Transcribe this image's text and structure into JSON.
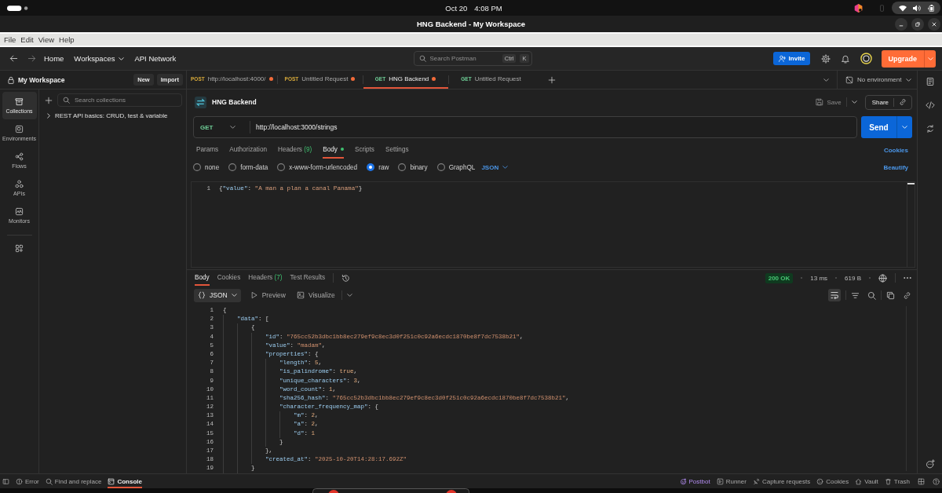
{
  "system_bar": {
    "date": "Oct 20",
    "time": "4:08 PM"
  },
  "window": {
    "title": "HNG Backend - My Workspace"
  },
  "menu": [
    "File",
    "Edit",
    "View",
    "Help"
  ],
  "header": {
    "nav": [
      {
        "label": "Home",
        "kind": "link"
      },
      {
        "label": "Workspaces",
        "kind": "menu"
      },
      {
        "label": "API Network",
        "kind": "link"
      }
    ],
    "search": {
      "placeholder": "Search Postman",
      "shortcut": [
        "Ctrl",
        "K"
      ]
    },
    "invite": "Invite",
    "upgrade": "Upgrade"
  },
  "sidebar": {
    "workspace": "My Workspace",
    "buttons": [
      "New",
      "Import"
    ],
    "nav": [
      {
        "label": "Collections",
        "selected": true
      },
      {
        "label": "Environments",
        "selected": false
      },
      {
        "label": "Flows",
        "selected": false
      },
      {
        "label": "APIs",
        "selected": false
      },
      {
        "label": "Monitors",
        "selected": false
      }
    ],
    "search": {
      "placeholder": "Search collections"
    },
    "collections": [
      {
        "name": "REST API basics: CRUD, test & variable",
        "expanded": false
      }
    ]
  },
  "tabs": [
    {
      "method": "POST",
      "color": "#d6a93a",
      "title": "http://localhost:4000/",
      "unsaved": true,
      "selected": false
    },
    {
      "method": "POST",
      "color": "#d6a93a",
      "title": "Untitled Request",
      "unsaved": true,
      "selected": false
    },
    {
      "method": "GET",
      "color": "#6fcf97",
      "title": "HNG Backend",
      "unsaved": true,
      "selected": true
    },
    {
      "method": "GET",
      "color": "#6fcf97",
      "title": "Untitled Request",
      "unsaved": false,
      "selected": false
    }
  ],
  "environment": "No environment",
  "request": {
    "title": "HNG Backend",
    "save": "Save",
    "share": "Share",
    "method": "GET",
    "url": "http://localhost:3000/strings",
    "send": "Send",
    "tabs": [
      {
        "label": "Params",
        "selected": false,
        "dot": false
      },
      {
        "label": "Authorization",
        "selected": false,
        "dot": false
      },
      {
        "label": "Headers",
        "count": "(9)",
        "selected": false,
        "dot": false
      },
      {
        "label": "Body",
        "selected": true,
        "dot": true
      },
      {
        "label": "Scripts",
        "selected": false,
        "dot": false
      },
      {
        "label": "Settings",
        "selected": false,
        "dot": false
      }
    ],
    "cookies": "Cookies",
    "body_types": [
      {
        "label": "none",
        "selected": false
      },
      {
        "label": "form-data",
        "selected": false
      },
      {
        "label": "x-www-form-urlencoded",
        "selected": false
      },
      {
        "label": "raw",
        "selected": true
      },
      {
        "label": "binary",
        "selected": false
      },
      {
        "label": "GraphQL",
        "selected": false
      }
    ],
    "format": "JSON",
    "beautify": "Beautify",
    "body_lines": [
      {
        "number": "1",
        "tokens": [
          {
            "kind": "punct",
            "text": "{"
          },
          {
            "kind": "key",
            "text": "\"value\""
          },
          {
            "kind": "punct",
            "text": ": "
          },
          {
            "kind": "string",
            "text": "\"A man a plan a canal Panama\""
          },
          {
            "kind": "punct",
            "text": "}"
          }
        ]
      }
    ]
  },
  "response": {
    "tabs": [
      {
        "label": "Body",
        "selected": true
      },
      {
        "label": "Cookies",
        "selected": false
      },
      {
        "label": "Headers",
        "count": "(7)",
        "selected": false
      },
      {
        "label": "Test Results",
        "selected": false
      }
    ],
    "status": "200 OK",
    "time": "13 ms",
    "size": "619 B",
    "views": [
      {
        "label": "JSON",
        "selected": true
      },
      {
        "label": "Preview",
        "selected": false
      },
      {
        "label": "Visualize",
        "selected": false
      }
    ],
    "line_wrap": true,
    "lines": [
      {
        "number": "1",
        "tokens": [
          {
            "kind": "punct",
            "text": "{"
          }
        ],
        "children": [
          {
            "number": "2",
            "tokens": [
              {
                "kind": "key",
                "text": "\"data\""
              },
              {
                "kind": "punct",
                "text": ": ["
              }
            ],
            "children": [
              {
                "number": "3",
                "tokens": [
                  {
                    "kind": "punct",
                    "text": "{"
                  }
                ],
                "children": [
                  {
                    "number": "4",
                    "tokens": [
                      {
                        "kind": "key",
                        "text": "\"id\""
                      },
                      {
                        "kind": "punct",
                        "text": ": "
                      },
                      {
                        "kind": "string",
                        "text": "\"765cc52b3dbc1bb8ec279ef9c8ec3d0f251c0c92a6ecdc1870be8f7dc7538b21\""
                      },
                      {
                        "kind": "punct",
                        "text": ","
                      }
                    ]
                  },
                  {
                    "number": "5",
                    "tokens": [
                      {
                        "kind": "key",
                        "text": "\"value\""
                      },
                      {
                        "kind": "punct",
                        "text": ": "
                      },
                      {
                        "kind": "string",
                        "text": "\"madam\""
                      },
                      {
                        "kind": "punct",
                        "text": ","
                      }
                    ]
                  },
                  {
                    "number": "6",
                    "tokens": [
                      {
                        "kind": "key",
                        "text": "\"properties\""
                      },
                      {
                        "kind": "punct",
                        "text": ": {"
                      }
                    ],
                    "children": [
                      {
                        "number": "7",
                        "tokens": [
                          {
                            "kind": "key",
                            "text": "\"length\""
                          },
                          {
                            "kind": "punct",
                            "text": ": "
                          },
                          {
                            "kind": "number",
                            "text": "5"
                          },
                          {
                            "kind": "punct",
                            "text": ","
                          }
                        ]
                      },
                      {
                        "number": "8",
                        "tokens": [
                          {
                            "kind": "key",
                            "text": "\"is_palindrome\""
                          },
                          {
                            "kind": "punct",
                            "text": ": "
                          },
                          {
                            "kind": "number",
                            "text": "true"
                          },
                          {
                            "kind": "punct",
                            "text": ","
                          }
                        ]
                      },
                      {
                        "number": "9",
                        "tokens": [
                          {
                            "kind": "key",
                            "text": "\"unique_characters\""
                          },
                          {
                            "kind": "punct",
                            "text": ": "
                          },
                          {
                            "kind": "number",
                            "text": "3"
                          },
                          {
                            "kind": "punct",
                            "text": ","
                          }
                        ]
                      },
                      {
                        "number": "10",
                        "tokens": [
                          {
                            "kind": "key",
                            "text": "\"word_count\""
                          },
                          {
                            "kind": "punct",
                            "text": ": "
                          },
                          {
                            "kind": "number",
                            "text": "1"
                          },
                          {
                            "kind": "punct",
                            "text": ","
                          }
                        ]
                      },
                      {
                        "number": "11",
                        "tokens": [
                          {
                            "kind": "key",
                            "text": "\"sha256_hash\""
                          },
                          {
                            "kind": "punct",
                            "text": ": "
                          },
                          {
                            "kind": "string",
                            "text": "\"765cc52b3dbc1bb8ec279ef9c8ec3d0f251c0c92a6ecdc1870be8f7dc7538b21\""
                          },
                          {
                            "kind": "punct",
                            "text": ","
                          }
                        ]
                      },
                      {
                        "number": "12",
                        "tokens": [
                          {
                            "kind": "key",
                            "text": "\"character_frequency_map\""
                          },
                          {
                            "kind": "punct",
                            "text": ": {"
                          }
                        ],
                        "children": [
                          {
                            "number": "13",
                            "tokens": [
                              {
                                "kind": "key",
                                "text": "\"m\""
                              },
                              {
                                "kind": "punct",
                                "text": ": "
                              },
                              {
                                "kind": "number",
                                "text": "2"
                              },
                              {
                                "kind": "punct",
                                "text": ","
                              }
                            ]
                          },
                          {
                            "number": "14",
                            "tokens": [
                              {
                                "kind": "key",
                                "text": "\"a\""
                              },
                              {
                                "kind": "punct",
                                "text": ": "
                              },
                              {
                                "kind": "number",
                                "text": "2"
                              },
                              {
                                "kind": "punct",
                                "text": ","
                              }
                            ]
                          },
                          {
                            "number": "15",
                            "tokens": [
                              {
                                "kind": "key",
                                "text": "\"d\""
                              },
                              {
                                "kind": "punct",
                                "text": ": "
                              },
                              {
                                "kind": "number",
                                "text": "1"
                              }
                            ]
                          }
                        ]
                      },
                      {
                        "number": "16",
                        "tokens": [
                          {
                            "kind": "punct",
                            "text": "}"
                          }
                        ]
                      }
                    ]
                  },
                  {
                    "number": "17",
                    "tokens": [
                      {
                        "kind": "punct",
                        "text": "},"
                      }
                    ]
                  },
                  {
                    "number": "18",
                    "tokens": [
                      {
                        "kind": "key",
                        "text": "\"created_at\""
                      },
                      {
                        "kind": "punct",
                        "text": ": "
                      },
                      {
                        "kind": "string",
                        "text": "\"2025-10-20T14:28:17.692Z\""
                      }
                    ]
                  }
                ]
              },
              {
                "number": "19",
                "tokens": [
                  {
                    "kind": "punct",
                    "text": "}"
                  }
                ]
              }
            ]
          }
        ]
      }
    ]
  },
  "status_bar": {
    "left": [
      {
        "label": "Error",
        "selected": false
      },
      {
        "label": "Find and replace",
        "selected": false
      },
      {
        "label": "Console",
        "selected": true
      }
    ],
    "postbot": "Postbot",
    "tools": [
      "Runner",
      "Capture requests",
      "Cookies",
      "Vault",
      "Trash"
    ]
  }
}
